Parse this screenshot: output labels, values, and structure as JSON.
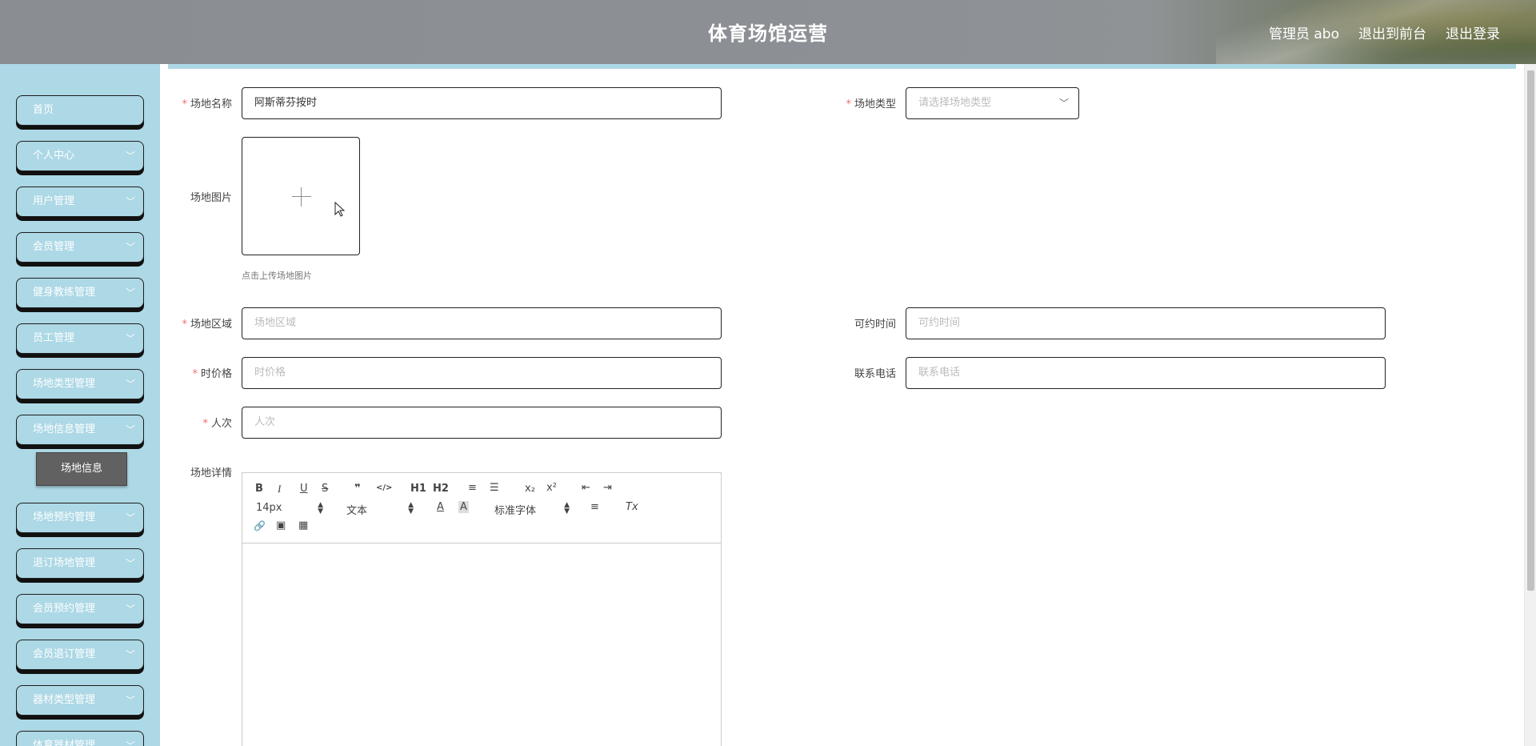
{
  "header": {
    "title": "体育场馆运营",
    "user_label": "管理员 abo",
    "to_front_label": "退出到前台",
    "logout_label": "退出登录"
  },
  "sidebar": {
    "items": [
      {
        "label": "首页"
      },
      {
        "label": "个人中心"
      },
      {
        "label": "用户管理"
      },
      {
        "label": "会员管理"
      },
      {
        "label": "健身教练管理"
      },
      {
        "label": "员工管理"
      },
      {
        "label": "场地类型管理"
      },
      {
        "label": "场地信息管理"
      },
      {
        "label": "场地预约管理"
      },
      {
        "label": "退订场地管理"
      },
      {
        "label": "会员预约管理"
      },
      {
        "label": "会员退订管理"
      },
      {
        "label": "器材类型管理"
      },
      {
        "label": "体育器材管理"
      }
    ],
    "submenu": {
      "label": "场地信息"
    }
  },
  "form": {
    "venue_name": {
      "label": "场地名称",
      "value": "阿斯蒂芬按时"
    },
    "venue_type": {
      "label": "场地类型",
      "placeholder": "请选择场地类型"
    },
    "venue_image": {
      "label": "场地图片",
      "hint": "点击上传场地图片"
    },
    "venue_area": {
      "label": "场地区域",
      "placeholder": "场地区域"
    },
    "bookable_time": {
      "label": "可约时间",
      "placeholder": "可约时间"
    },
    "hourly_price": {
      "label": "时价格",
      "placeholder": "时价格"
    },
    "phone": {
      "label": "联系电话",
      "placeholder": "联系电话"
    },
    "headcount": {
      "label": "人次",
      "placeholder": "人次"
    },
    "details": {
      "label": "场地详情"
    }
  },
  "editor": {
    "toolbar": {
      "bold": "B",
      "italic": "I",
      "underline": "U",
      "strike": "S",
      "quote": "❞",
      "code": "</>",
      "h1": "H1",
      "h2": "H2",
      "ordered_list": "≡",
      "bullet_list": "☰",
      "subscript": "x₂",
      "superscript": "x²",
      "outdent": "⇤",
      "indent": "⇥",
      "font_size": "14px",
      "paragraph": "文本",
      "font_color": "A",
      "bg_color": "A",
      "font_family": "标准字体",
      "align": "≡",
      "clean": "Tx",
      "link": "🔗",
      "image": "▣",
      "video": "▦"
    }
  },
  "colors": {
    "sidebar_bg": "#add8e6",
    "required": "#f56c6c",
    "submenu_bg": "#616161"
  }
}
